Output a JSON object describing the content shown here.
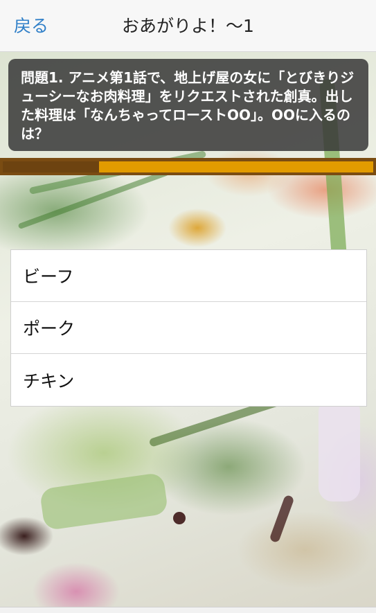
{
  "header": {
    "back_label": "戻る",
    "title": "おあがりよ！〜1"
  },
  "question": {
    "text": "問題1. アニメ第1話で、地上げ屋の女に「とびきりジューシーなお肉料理」をリクエストされた創真。出した料理は「なんちゃってローストOO」。OOに入るのは？"
  },
  "timer": {
    "remaining_fraction": 0.74
  },
  "answers": [
    {
      "label": "ビーフ"
    },
    {
      "label": "ポーク"
    },
    {
      "label": "チキン"
    }
  ],
  "colors": {
    "accent": "#2f7fc8",
    "timer_fill": "#e29b00",
    "timer_elapsed": "#6d4310"
  }
}
